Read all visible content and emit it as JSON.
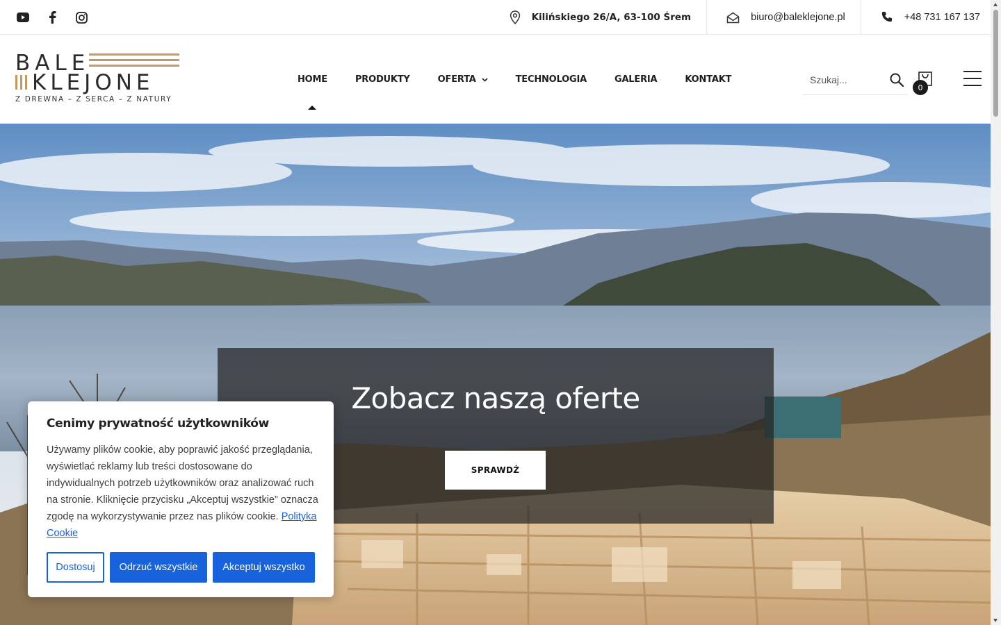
{
  "topbar": {
    "social": [
      {
        "icon": "youtube-icon"
      },
      {
        "icon": "facebook-icon"
      },
      {
        "icon": "instagram-icon"
      }
    ],
    "address": "Kilińskiego 26/A, 63-100 Śrem",
    "email": "biuro@baleklejone.pl",
    "phone": "+48 731 167 137"
  },
  "logo": {
    "word1": "BALE",
    "word2": "KLEJONE",
    "tagline": "Z DREWNA – Z SERCA – Z NATURY",
    "accent_color": "#c49a62"
  },
  "nav": {
    "items": [
      {
        "label": "HOME",
        "active": true
      },
      {
        "label": "PRODUKTY"
      },
      {
        "label": "OFERTA",
        "has_dropdown": true
      },
      {
        "label": "TECHNOLOGIA"
      },
      {
        "label": "GALERIA"
      },
      {
        "label": "KONTAKT"
      }
    ]
  },
  "search": {
    "placeholder": "Szukaj..."
  },
  "cart": {
    "count": "0"
  },
  "hero": {
    "title": "Zobacz naszą oferte",
    "button": "SPRAWDŹ"
  },
  "cookie": {
    "title": "Cenimy prywatność użytkowników",
    "text": "Używamy plików cookie, aby poprawić jakość przeglądania, wyświetlać reklamy lub treści dostosowane do indywidualnych potrzeb użytkowników oraz analizować ruch na stronie. Kliknięcie przycisku „Akceptuj wszystkie” oznacza zgodę na wykorzystywanie przez nas plików cookie.",
    "policy_link": "Polityka Cookie",
    "customize": "Dostosuj",
    "reject": "Odrzuć wszystkie",
    "accept": "Akceptuj wszystko",
    "button_color": "#1863dc"
  }
}
